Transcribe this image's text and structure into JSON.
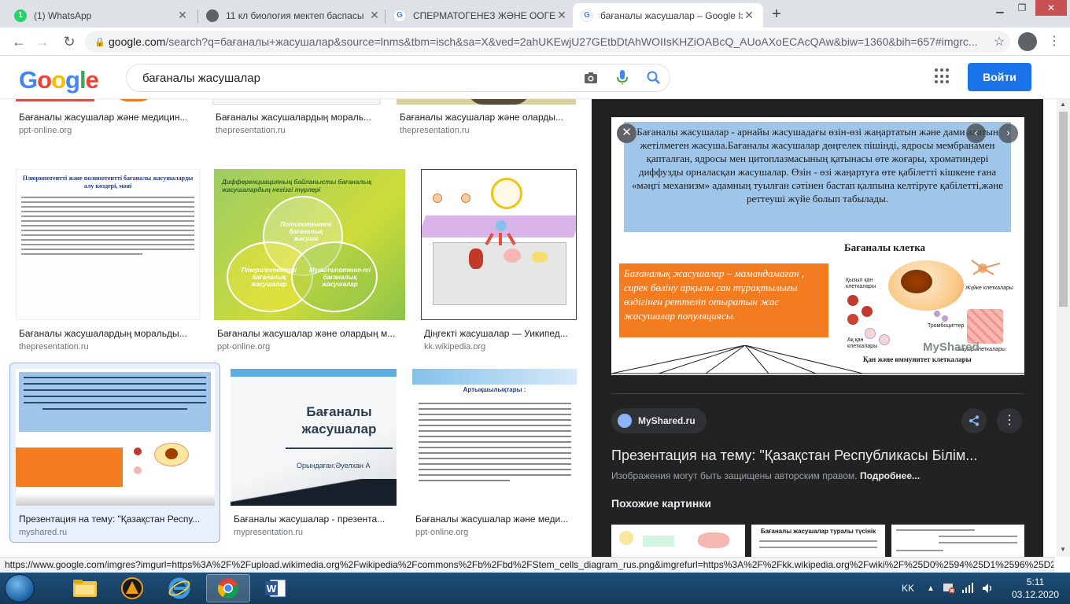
{
  "browser": {
    "tabs": [
      {
        "title": "(1) WhatsApp",
        "favicon_color": "#25d366",
        "favicon_text": "1",
        "active": false
      },
      {
        "title": "11 кл биология мектеп баспасы",
        "favicon_color": "#5f6368",
        "favicon_text": "",
        "active": false
      },
      {
        "title": "СПЕРМАТОГЕНЕЗ ЖӘНЕ ООГЕНЕЗ",
        "favicon_color": "#4285f4",
        "favicon_text": "G",
        "active": false
      },
      {
        "title": "бағаналы жасушалар – Google Іздеу",
        "favicon_color": "#4285f4",
        "favicon_text": "G",
        "active": true
      }
    ],
    "new_tab_label": "+",
    "url_host": "google.com",
    "url_rest": "/search?q=бағаналы+жасушалар&source=lnms&tbm=isch&sa=X&ved=2ahUKEwjU27GEtbDtAhWOIIsKHZiOABcQ_AUoAXoECAcQAw&biw=1360&bih=657#imgrc..."
  },
  "google": {
    "logo_letters": [
      "G",
      "o",
      "o",
      "g",
      "l",
      "e"
    ],
    "query": "бағаналы жасушалар",
    "signin_label": "Войти"
  },
  "results": {
    "row0": [
      {
        "title": "Бағаналы жасушалар және медицин...",
        "site": "ppt-online.org"
      },
      {
        "title": "Бағаналы жасушалардың мораль...",
        "site": "thepresentation.ru"
      },
      {
        "title": "Бағаналы жасушалар және оларды...",
        "site": "thepresentation.ru"
      }
    ],
    "row1": [
      {
        "title": "Бағаналы жасушалардың моральды...",
        "site": "thepresentation.ru"
      },
      {
        "title": "Бағаналы жасушалар және олардың м...",
        "site": "ppt-online.org"
      },
      {
        "title": "Діңгекті жасушалар — Уикипед...",
        "site": "kk.wikipedia.org"
      }
    ],
    "row2": [
      {
        "title": "Презентация на тему: \"Қазақстан Респу...",
        "site": "myshared.ru"
      },
      {
        "title": "Бағаналы жасушалар - презента...",
        "site": "mypresentation.ru"
      },
      {
        "title": "Бағаналы жасушалар және меди...",
        "site": "ppt-online.org"
      }
    ],
    "thumb_texts": {
      "t1_heading": "Плюрипотентті және полипотентті бағаналы жасушаларды алу көздері, мәні",
      "t2_heading": "Дифференциацияның байланысты бағаналық жасушалардың негізгі түрлері",
      "t2_c1": "Потипотентті бағаналық жасуша",
      "t2_c2": "Плюрипотентті бағаналық жасушалар",
      "t2_c3": "Мультипотент-ті бағаналық жасушалар",
      "t5_title": "Бағаналы жасушалар",
      "t5_author": "Орындаған:Әуелхан А",
      "t6_heading": "Артықшылықтары :"
    }
  },
  "preview": {
    "text_blue": "Бағаналы жасушалар - арнайы жасушадағы өзін-өзі жаңартатын және дами алатын жетілмеген жасуша.Бағаналы жасушалар дөңгелек пішінді, ядросы мембранамен қапталған, ядросы мен цитоплазмасының қатынасы өте жоғары, хроматиндері диффузды орналасқан жасушалар. Өзін - өзі жаңартуға өте қабілетті кішкене ғана «мәңгі механизм» адамның туылған сәтінен бастап қалпына келтіруге қабілетті,және реттеушi жүйе болып табылады.",
    "text_orange": "Бағаналық жасушалар – мамандамаған , сирек бөліну арқылы сан тұрақтылығы өздігінен реттеліп отыратын жас жасушалар популяциясы.",
    "diagram_title": "Бағаналы клетка",
    "labels": [
      "Қызыл қан клеткалары",
      "Жүйке клеткалары",
      "Тромбоциттер",
      "Бауыр клеткалары",
      "Ақ қан клеткалары"
    ],
    "bottom_label": "Қан және иммунитет клеткалары",
    "watermark": "MyShared",
    "source": "MyShared.ru",
    "title": "Презентация на тему: \"Қазақстан Республикасы Білім...",
    "copyright": "Изображения могут быть защищены авторским правом.",
    "copyright_more": "Подробнее...",
    "similar_heading": "Похожие картинки",
    "sim2_text": "Бағаналы жасушалар туралы түсінік"
  },
  "status_url": "https://www.google.com/imgres?imgurl=https%3A%2F%2Fupload.wikimedia.org%2Fwikipedia%2Fcommons%2Fb%2Fbd%2FStem_cells_diagram_rus.png&imgrefurl=https%3A%2F%2Fkk.wikipedia.org%2Fwiki%2F%25D0%2594%25D1%2596%25D2...",
  "taskbar": {
    "lang": "KK",
    "time": "5:11",
    "date": "03.12.2020"
  },
  "colors": {
    "google_blue": "#1a73e8",
    "panel_bg": "#222222",
    "preview_blue_box": "#9fc5e8",
    "preview_orange_box": "#f47c20"
  }
}
